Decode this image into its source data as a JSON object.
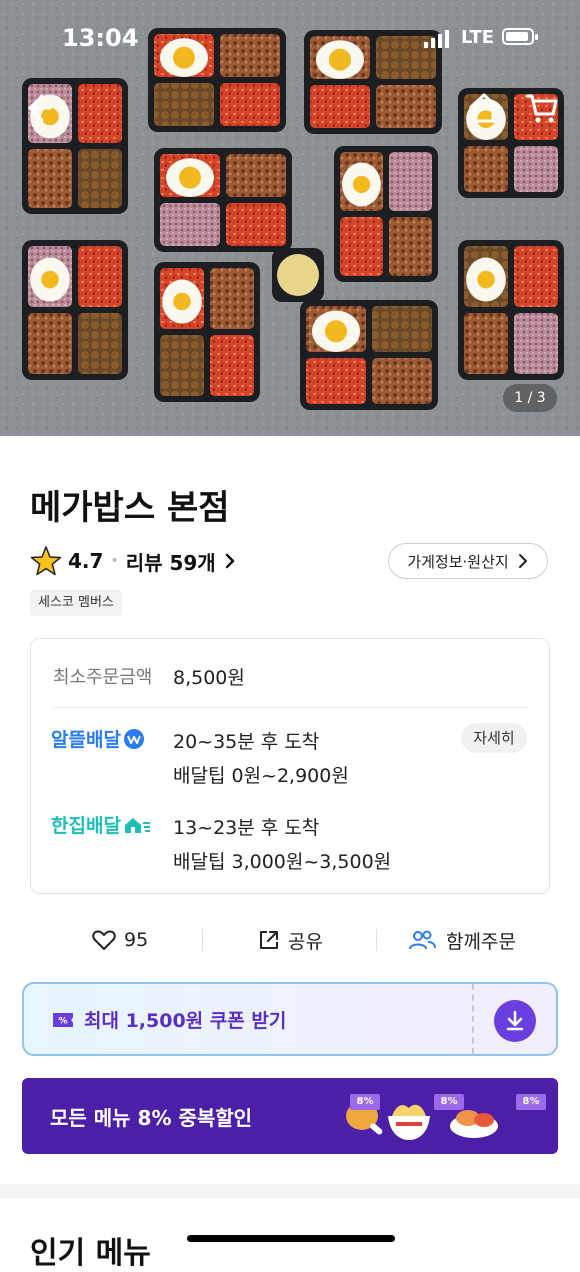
{
  "status_bar": {
    "time": "13:04",
    "network": "LTE"
  },
  "hero": {
    "pager": "1 / 3"
  },
  "store": {
    "name": "메가밥스 본점",
    "rating": "4.7",
    "reviews": "리뷰 59개",
    "info_button": "가게정보·원산지",
    "badge": "세스코 멤버스"
  },
  "delivery_card": {
    "min_order_label": "최소주문금액",
    "min_order_value": "8,500원",
    "options": [
      {
        "name": "알뜰배달",
        "time": "20~35분 후 도착",
        "tip": "배달팁 0원~2,900원",
        "detail": "자세히"
      },
      {
        "name": "한집배달",
        "time": "13~23분 후 도착",
        "tip": "배달팁 3,000원~3,500원"
      }
    ]
  },
  "actions": {
    "like_count": "95",
    "share": "공유",
    "group_order": "함께주문"
  },
  "coupon": {
    "text": "최대 1,500원 쿠폰 받기"
  },
  "promo_banner": {
    "text": "모든 메뉴 8% 중복할인",
    "tags": [
      "8%",
      "8%",
      "8%"
    ]
  },
  "section": {
    "popular_title": "인기 메뉴"
  },
  "colors": {
    "purple": "#4c1fa8",
    "blue": "#2a7df0",
    "teal": "#1fbfb8",
    "coupon_purple": "#6a3fe0"
  }
}
